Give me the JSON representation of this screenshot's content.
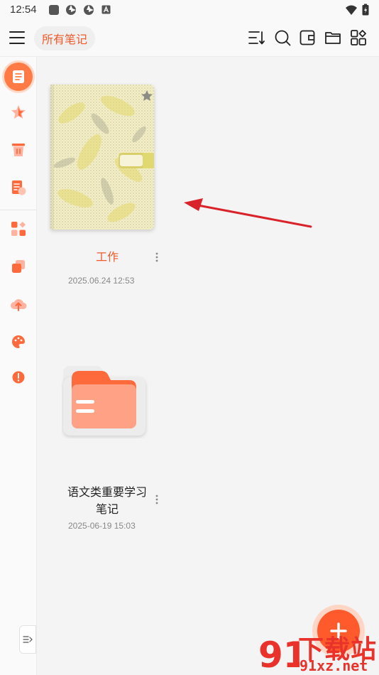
{
  "status_bar": {
    "time": "12:54",
    "notification_icons": [
      "square-icon",
      "aperture-icon",
      "aperture-icon",
      "a-box-icon"
    ],
    "right_icons": [
      "wifi-icon",
      "battery-charging-icon"
    ]
  },
  "header": {
    "title": "所有笔记",
    "actions": [
      "sort-icon",
      "search-icon",
      "wallet-icon",
      "folder-icon",
      "grid-plus-icon"
    ]
  },
  "sidebar": {
    "items": [
      {
        "icon": "notes-list-icon",
        "active": true
      },
      {
        "icon": "star-icon",
        "active": false
      },
      {
        "icon": "trash-icon",
        "active": false
      },
      {
        "icon": "document-clock-icon",
        "active": false
      },
      {
        "icon": "apps-grid-icon",
        "active": false
      },
      {
        "icon": "layers-icon",
        "active": false
      },
      {
        "icon": "cloud-upload-icon",
        "active": false
      },
      {
        "icon": "palette-icon",
        "active": false
      },
      {
        "icon": "info-icon",
        "active": false
      }
    ],
    "collapse_icon": "expand-sidebar-icon"
  },
  "notes": [
    {
      "type": "notebook",
      "title": "工作",
      "date": "2025.06.24 12:53",
      "title_color": "#f05a2a"
    },
    {
      "type": "folder",
      "title_line1": "语文类重要学习",
      "title_line2": "笔记",
      "date": "2025-06-19 15:03"
    }
  ],
  "fab": {
    "icon": "plus-icon"
  },
  "watermark": {
    "brand": "下载站",
    "site": "91xz.net",
    "logo_text": "91"
  },
  "colors": {
    "accent": "#ff5a2c",
    "accent_light": "#ffd5c6",
    "annotation_arrow": "#d9232a",
    "folder_front": "#ffa184",
    "folder_back": "#ff6a3d"
  }
}
